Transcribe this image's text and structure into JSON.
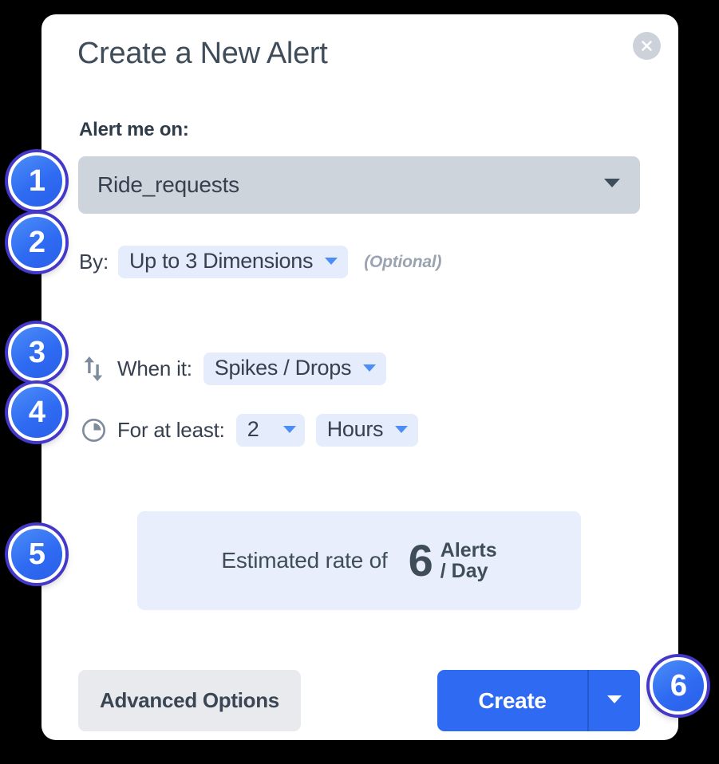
{
  "dialog": {
    "title": "Create a New Alert",
    "close_icon": "close-icon"
  },
  "alert_on": {
    "label": "Alert me on:",
    "selected": "Ride_requests",
    "caret_icon": "chevron-down-icon"
  },
  "by": {
    "label": "By:",
    "selected": "Up to 3 Dimensions",
    "optional_note": "(Optional)",
    "caret_icon": "chevron-down-icon"
  },
  "when": {
    "icon": "arrows-up-down-icon",
    "label": "When it:",
    "selected": "Spikes / Drops",
    "caret_icon": "chevron-down-icon"
  },
  "for_at_least": {
    "icon": "clock-icon",
    "label": "For at least:",
    "amount": "2",
    "unit": "Hours",
    "caret_icon": "chevron-down-icon"
  },
  "estimate": {
    "prefix": "Estimated rate of",
    "value": "6",
    "unit_line1": "Alerts",
    "unit_line2": "/ Day"
  },
  "footer": {
    "advanced_label": "Advanced Options",
    "create_label": "Create",
    "create_caret_icon": "chevron-down-icon"
  },
  "callouts": [
    {
      "number": "1"
    },
    {
      "number": "2"
    },
    {
      "number": "3"
    },
    {
      "number": "4"
    },
    {
      "number": "5"
    },
    {
      "number": "6"
    }
  ],
  "colors": {
    "accent": "#2f6bf2",
    "badge_ring": "#4338ca",
    "pill_bg": "#e5ecfb",
    "select_bg": "#ced4db",
    "estimate_bg": "#e8eefc",
    "text_dark": "#36404f",
    "muted": "#9aa3b0"
  }
}
